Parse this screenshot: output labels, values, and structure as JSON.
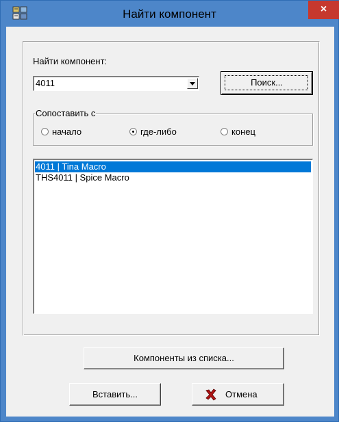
{
  "window": {
    "title": "Найти компонент",
    "close_glyph": "×",
    "icon": "app-components-icon"
  },
  "search": {
    "label": "Найти компонент:",
    "value": "4011",
    "button_label": "Поиск..."
  },
  "match": {
    "legend": "Сопоставить с",
    "options": [
      {
        "label": "начало",
        "selected": false
      },
      {
        "label": "где-либо",
        "selected": true
      },
      {
        "label": "конец",
        "selected": false
      }
    ]
  },
  "results": {
    "items": [
      {
        "label": "4011 | Tina Macro",
        "selected": true
      },
      {
        "label": "THS4011 | Spice Macro",
        "selected": false
      }
    ]
  },
  "buttons": {
    "components_from_list": "Компоненты из списка...",
    "insert": "Вставить...",
    "cancel": "Отмена",
    "cancel_icon": "red-x-icon"
  },
  "colors": {
    "titlebar": "#4d86c9",
    "close": "#c6382e",
    "selection": "#0078d7",
    "dialog": "#f0f0f0"
  }
}
